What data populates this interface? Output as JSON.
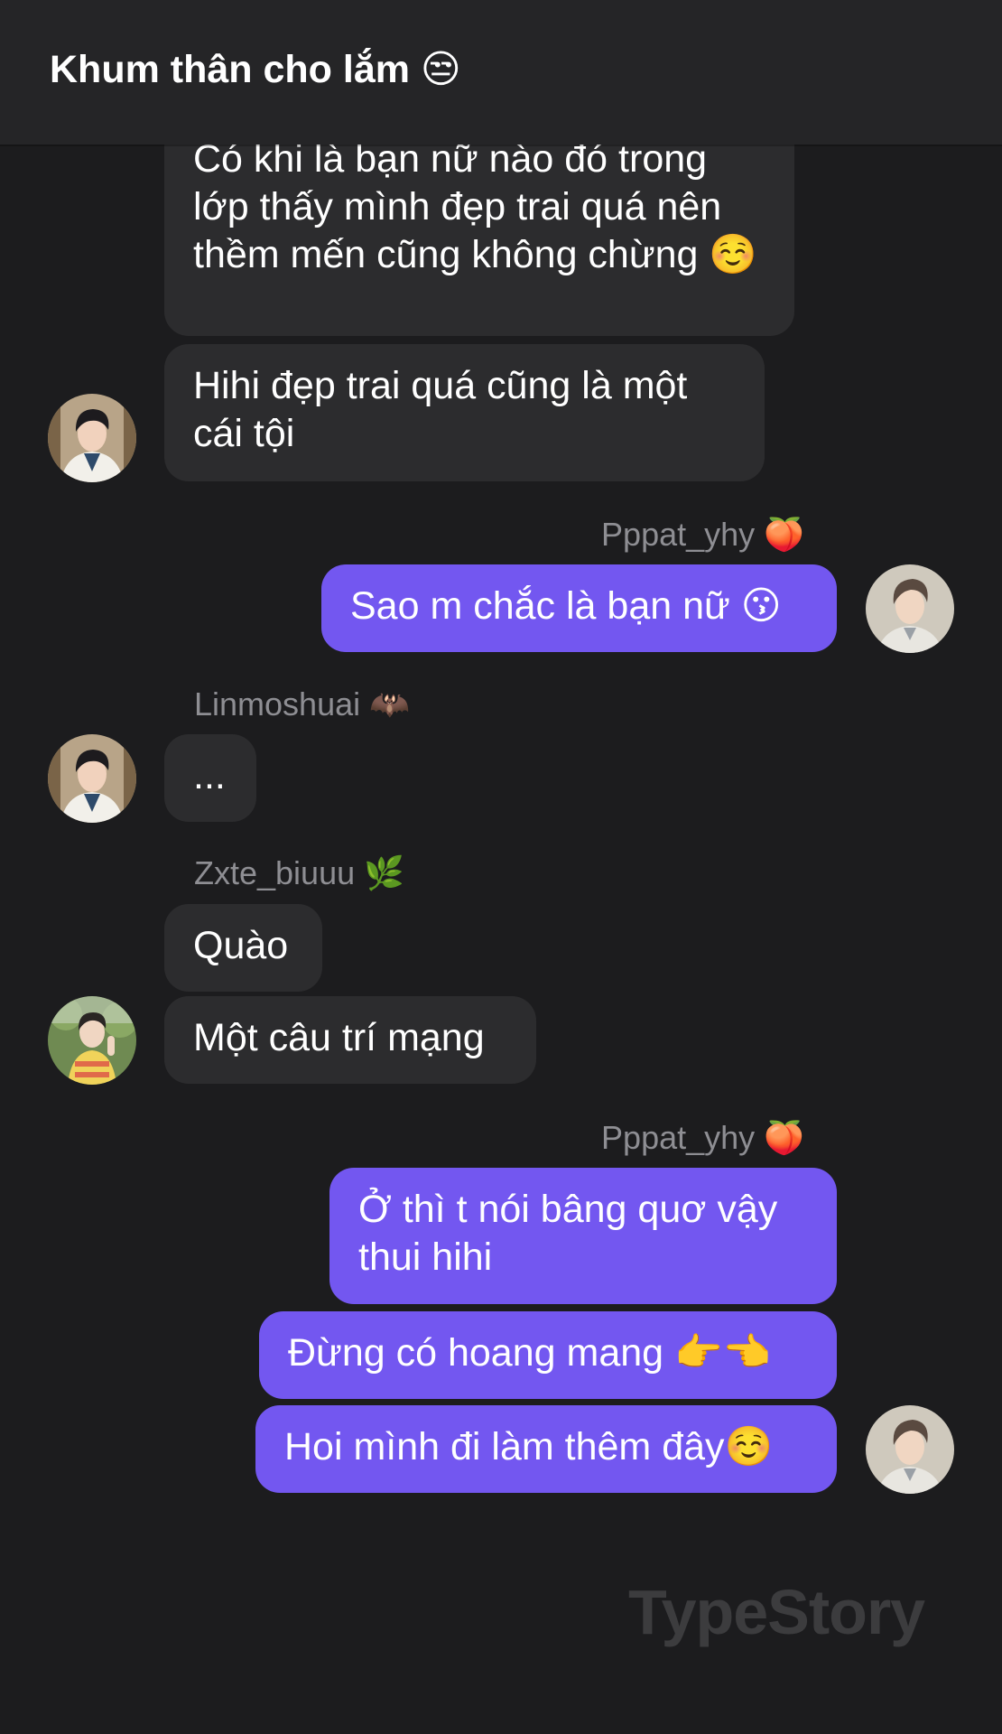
{
  "header": {
    "title": "Khum thân cho lắm 😒"
  },
  "messages": [
    {
      "direction": "incoming",
      "sender": "",
      "text": "Có khi là bạn nữ nào đó trong lớp thấy mình đẹp trai quá nên thềm mến cũng không chừng ☺️"
    },
    {
      "direction": "incoming",
      "sender": "",
      "text": "Hihi đẹp trai quá cũng là một cái tội"
    },
    {
      "direction": "outgoing",
      "sender": "Pppat_yhy 🍑",
      "text": "Sao m chắc là bạn nữ 😗"
    },
    {
      "direction": "incoming",
      "sender": "Linmoshuai 🦇",
      "text": "..."
    },
    {
      "direction": "incoming",
      "sender": "Zxte_biuuu 🌿",
      "text": "Quào"
    },
    {
      "direction": "incoming",
      "sender": "",
      "text": "Một câu trí mạng"
    },
    {
      "direction": "outgoing",
      "sender": "Pppat_yhy 🍑",
      "text": "Ở thì t nói bâng quơ vậy thui hihi"
    },
    {
      "direction": "outgoing",
      "sender": "",
      "text": "Đừng có hoang mang 👉👈"
    },
    {
      "direction": "outgoing",
      "sender": "",
      "text": "Hoi mình đi làm thêm đây☺️"
    }
  ],
  "watermark": "TypeStory",
  "colors": {
    "background": "#1c1c1e",
    "header": "#252527",
    "incoming_bubble": "#2c2c2e",
    "outgoing_bubble": "#7357f0",
    "sender_name": "#8e8e93"
  }
}
